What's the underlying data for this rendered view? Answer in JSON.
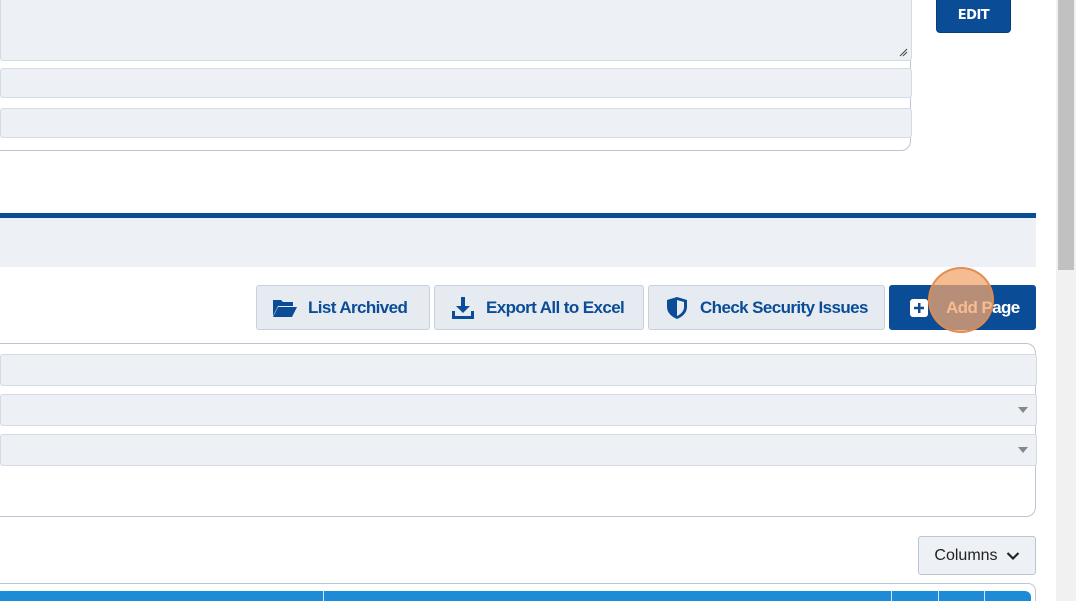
{
  "top_form": {
    "edit_label": "EDIT"
  },
  "toolbar": {
    "list_archived": "List Archived",
    "export_excel": "Export All to Excel",
    "check_security": "Check Security Issues",
    "add_page": "Add Page"
  },
  "table": {
    "columns_label": "Columns"
  },
  "colors": {
    "primary": "#0a4c96",
    "table_header": "#1e8bd6",
    "field_bg": "#edf0f5"
  }
}
